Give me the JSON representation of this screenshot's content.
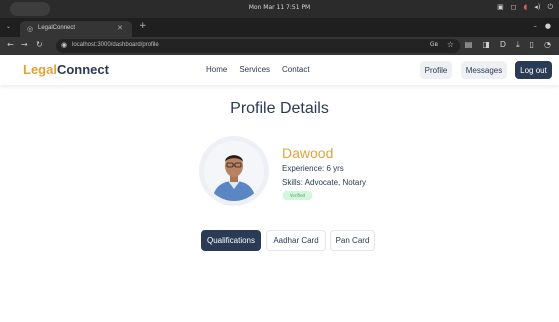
{
  "os": {
    "clock": "Mon Mar 11  7:51 PM",
    "tray_icons": [
      "network-icon",
      "display-icon",
      "audio-icon",
      "volume-icon",
      "power-icon"
    ]
  },
  "browser": {
    "tab_title": "LegalConnect",
    "url": "localhost:3000/dashboard/profile"
  },
  "navbar": {
    "logo_part1": "Legal",
    "logo_part2": "Connect",
    "links": [
      "Home",
      "Services",
      "Contact"
    ],
    "buttons": {
      "profile": "Profile",
      "messages": "Messages",
      "logout": "Log out"
    }
  },
  "profile": {
    "title": "Profile Details",
    "name": "Dawood",
    "experience": "Experience: 6 yrs",
    "skills": "Skills: Advocate, Notary",
    "badge": "Verified"
  },
  "tabs": [
    "Qualifications",
    "Aadhar Card",
    "Pan Card"
  ],
  "colors": {
    "accent": "#e0a23b",
    "navy": "#2b3a55",
    "badge_bg": "#d6f5df",
    "badge_text": "#3aa65b"
  }
}
